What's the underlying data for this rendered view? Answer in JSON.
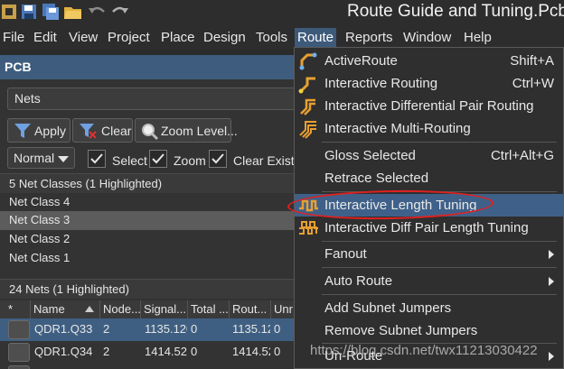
{
  "window": {
    "title": "Route Guide and Tuning.PcbD"
  },
  "menubar": {
    "items": [
      "File",
      "Edit",
      "View",
      "Project",
      "Place",
      "Design",
      "Tools",
      "Route",
      "Reports",
      "Window",
      "Help"
    ],
    "active": "Route"
  },
  "pcb_panel": {
    "title": "PCB",
    "mode_select": "Nets",
    "buttons": {
      "apply": "Apply",
      "clear": "Clear",
      "zoom": "Zoom Level..."
    },
    "highlight_mode": "Normal",
    "checkboxes": [
      {
        "label": "Select",
        "checked": true
      },
      {
        "label": "Zoom",
        "checked": true
      },
      {
        "label": "Clear Existin",
        "checked": true
      }
    ],
    "net_classes_header": "5 Net Classes (1 Highlighted)",
    "net_classes": [
      "Net Class 4",
      "Net Class 3",
      "Net Class 2",
      "Net Class 1"
    ],
    "net_classes_highlighted": "Net Class 3",
    "nets_header": "24 Nets (1 Highlighted)",
    "columns": [
      "*",
      "Name",
      "Node...",
      "Signal...",
      "Total ...",
      "Rout...",
      "Unr"
    ],
    "rows": [
      {
        "name": "QDR1.Q33",
        "nodes": "2",
        "signal": "1135.120",
        "total": "0",
        "routed": "1135.12",
        "unrouted": "0"
      },
      {
        "name": "QDR1.Q34",
        "nodes": "2",
        "signal": "1414.52!",
        "total": "0",
        "routed": "1414.52",
        "unrouted": "0"
      }
    ]
  },
  "route_menu": {
    "items": [
      {
        "label": "ActiveRoute",
        "shortcut": "Shift+A",
        "icon": "active-route-icon"
      },
      {
        "label": "Interactive Routing",
        "shortcut": "Ctrl+W",
        "icon": "interactive-routing-icon"
      },
      {
        "label": "Interactive Differential Pair Routing",
        "shortcut": "",
        "icon": "diff-pair-routing-icon"
      },
      {
        "label": "Interactive Multi-Routing",
        "shortcut": "",
        "icon": "multi-routing-icon"
      },
      {
        "label": "Gloss Selected",
        "shortcut": "Ctrl+Alt+G",
        "icon": ""
      },
      {
        "label": "Retrace Selected",
        "shortcut": "",
        "icon": ""
      },
      {
        "label": "Interactive Length Tuning",
        "shortcut": "",
        "icon": "length-tuning-icon"
      },
      {
        "label": "Interactive Diff Pair Length Tuning",
        "shortcut": "",
        "icon": "diff-pair-length-tuning-icon"
      },
      {
        "label": "Fanout",
        "shortcut": "",
        "icon": "",
        "submenu": true
      },
      {
        "label": "Auto Route",
        "shortcut": "",
        "icon": "",
        "submenu": true
      },
      {
        "label": "Add Subnet Jumpers",
        "shortcut": "",
        "icon": ""
      },
      {
        "label": "Remove Subnet Jumpers",
        "shortcut": "",
        "icon": ""
      },
      {
        "label": "Un-Route",
        "shortcut": "",
        "icon": "",
        "submenu": true
      }
    ],
    "highlighted": "Interactive Length Tuning"
  },
  "watermark": "https://blog.csdn.net/twx11213030422",
  "colors": {
    "accent": "#3f6189",
    "annotation": "#e02020"
  }
}
